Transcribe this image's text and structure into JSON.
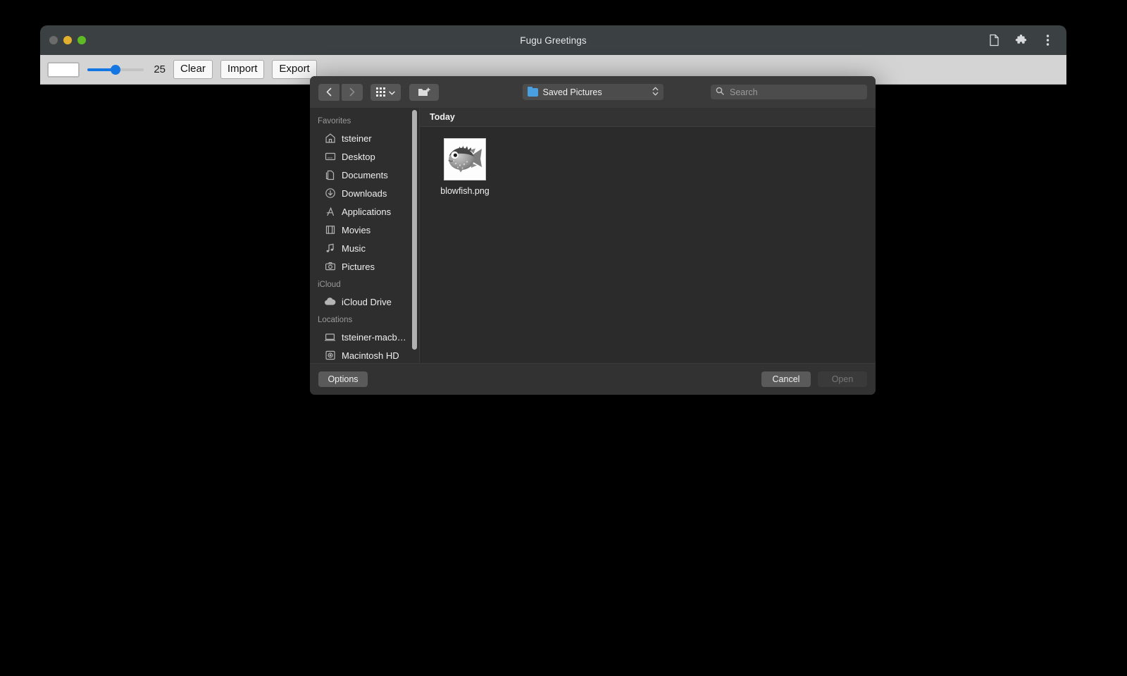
{
  "window": {
    "title": "Fugu Greetings",
    "traffic_lights": [
      "close",
      "minimize",
      "zoom"
    ],
    "titlebar_icons": [
      "page-icon",
      "extensions-puzzle-icon",
      "chrome-menu-icon"
    ]
  },
  "app_toolbar": {
    "color_swatch_value": "#ffffff",
    "thickness_value": "25",
    "slider_min": "1",
    "slider_max": "50",
    "buttons": [
      {
        "label": "Clear",
        "name": "clear-button"
      },
      {
        "label": "Import",
        "name": "import-button"
      },
      {
        "label": "Export",
        "name": "export-button"
      }
    ]
  },
  "dialog": {
    "toolbar": {
      "back_label": "‹",
      "forward_label": "›",
      "view_mode": "icon-grid",
      "new_folder_label": "New Folder",
      "path_label": "Saved Pictures",
      "search_placeholder": "Search",
      "search_value": ""
    },
    "sidebar": {
      "sections": [
        {
          "title": "Favorites",
          "items": [
            {
              "label": "tsteiner",
              "icon": "home-icon"
            },
            {
              "label": "Desktop",
              "icon": "desktop-icon"
            },
            {
              "label": "Documents",
              "icon": "documents-icon"
            },
            {
              "label": "Downloads",
              "icon": "downloads-icon"
            },
            {
              "label": "Applications",
              "icon": "applications-icon"
            },
            {
              "label": "Movies",
              "icon": "movies-icon"
            },
            {
              "label": "Music",
              "icon": "music-icon"
            },
            {
              "label": "Pictures",
              "icon": "pictures-icon"
            }
          ]
        },
        {
          "title": "iCloud",
          "items": [
            {
              "label": "iCloud Drive",
              "icon": "cloud-icon"
            }
          ]
        },
        {
          "title": "Locations",
          "items": [
            {
              "label": "tsteiner-macb…",
              "icon": "laptop-icon"
            },
            {
              "label": "Macintosh HD",
              "icon": "harddisk-icon"
            }
          ]
        }
      ]
    },
    "files": {
      "group_header": "Today",
      "items": [
        {
          "name": "blowfish.png",
          "thumbnail": "blowfish-image"
        }
      ]
    },
    "footer": {
      "options_label": "Options",
      "cancel_label": "Cancel",
      "open_label": "Open",
      "open_disabled": true
    }
  },
  "colors": {
    "accent_blue": "#1476e2",
    "dialog_bg": "#323232",
    "sidebar_bg": "#2e2e2e",
    "file_area_bg": "#2b2b2b",
    "titlebar_bg": "#3b4043",
    "canvas_bg": "#000000",
    "folder_blue": "#4a9fe0"
  }
}
